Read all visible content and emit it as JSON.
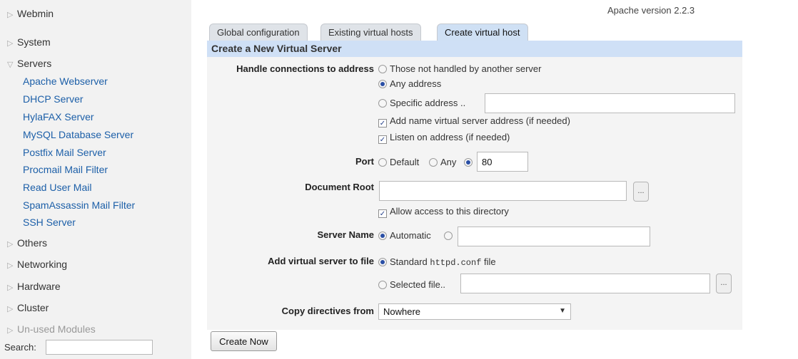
{
  "sidebar": {
    "categories": {
      "webmin": "Webmin",
      "system": "System",
      "servers": "Servers",
      "others": "Others",
      "networking": "Networking",
      "hardware": "Hardware",
      "cluster": "Cluster",
      "unused": "Un-used Modules"
    },
    "modules": [
      "Apache Webserver",
      "DHCP Server",
      "HylaFAX Server",
      "MySQL Database Server",
      "Postfix Mail Server",
      "Procmail Mail Filter",
      "Read User Mail",
      "SpamAssassin Mail Filter",
      "SSH Server"
    ],
    "search_label": "Search:",
    "search_value": ""
  },
  "header": {
    "apache_version": "Apache version 2.2.3"
  },
  "tabs": [
    "Global configuration",
    "Existing virtual hosts",
    "Create virtual host"
  ],
  "panel": {
    "title": "Create a New Virtual Server",
    "handle": {
      "label": "Handle connections to address",
      "opt_not_handled": "Those not handled by another server",
      "opt_any": "Any address",
      "opt_specific": "Specific address ..",
      "specific_value": "",
      "chk_add_name": "Add name virtual server address (if needed)",
      "chk_listen": "Listen on address (if needed)"
    },
    "port": {
      "label": "Port",
      "opt_default": "Default",
      "opt_any": "Any",
      "value": "80"
    },
    "docroot": {
      "label": "Document Root",
      "value": "",
      "browse": "...",
      "chk_allow": "Allow access to this directory"
    },
    "server_name": {
      "label": "Server Name",
      "opt_auto": "Automatic",
      "value": ""
    },
    "add_file": {
      "label": "Add virtual server to file",
      "opt_standard_pre": "Standard",
      "opt_standard_code": "httpd.conf",
      "opt_standard_post": "file",
      "opt_selected": "Selected file..",
      "selected_value": "",
      "browse": "..."
    },
    "copy": {
      "label": "Copy directives from",
      "selected": "Nowhere"
    }
  },
  "create_button": "Create Now",
  "colors": {
    "sidebar_bg": "#f2f2f2",
    "link": "#1c5fa8",
    "panel_title_bg": "#cfe0f6",
    "panel_bg": "#f4f4f4"
  }
}
